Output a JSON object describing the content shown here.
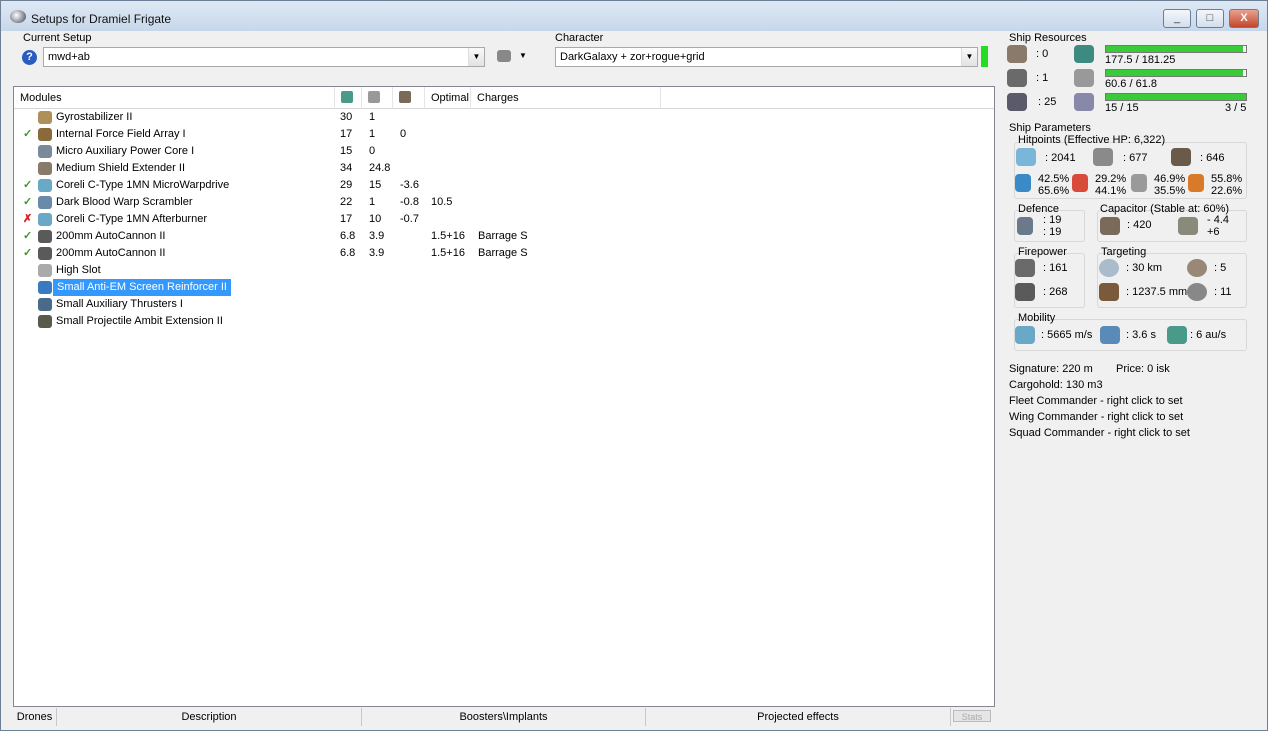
{
  "window": {
    "title": "Setups for Dramiel Frigate",
    "buttons": [
      "_",
      "□",
      "X"
    ]
  },
  "setup": {
    "label": "Current Setup",
    "value": "mwd+ab"
  },
  "character": {
    "label": "Character",
    "value": "DarkGalaxy + zor+rogue+grid"
  },
  "modules": {
    "columns": [
      "Modules",
      "Optimal",
      "Charges"
    ],
    "rows": [
      {
        "status": "",
        "name": "Gyrostabilizer II",
        "cpu": "30",
        "pg": "1",
        "cap": "",
        "optimal": "",
        "charges": ""
      },
      {
        "status": "✓",
        "name": "Internal Force Field Array I",
        "cpu": "17",
        "pg": "1",
        "cap": "0",
        "optimal": "",
        "charges": ""
      },
      {
        "status": "",
        "name": "Micro Auxiliary Power Core I",
        "cpu": "15",
        "pg": "0",
        "cap": "",
        "optimal": "",
        "charges": ""
      },
      {
        "status": "",
        "name": "Medium Shield Extender II",
        "cpu": "34",
        "pg": "24.8",
        "cap": "",
        "optimal": "",
        "charges": ""
      },
      {
        "status": "✓",
        "name": "Coreli C-Type 1MN MicroWarpdrive",
        "cpu": "29",
        "pg": "15",
        "cap": "-3.6",
        "optimal": "",
        "charges": ""
      },
      {
        "status": "✓",
        "name": "Dark Blood Warp Scrambler",
        "cpu": "22",
        "pg": "1",
        "cap": "-0.8",
        "optimal": "10.5",
        "charges": ""
      },
      {
        "status": "✗",
        "name": "Coreli C-Type 1MN Afterburner",
        "cpu": "17",
        "pg": "10",
        "cap": "-0.7",
        "optimal": "",
        "charges": ""
      },
      {
        "status": "✓",
        "name": "200mm AutoCannon II",
        "cpu": "6.8",
        "pg": "3.9",
        "cap": "",
        "optimal": "1.5+16",
        "charges": "Barrage S"
      },
      {
        "status": "✓",
        "name": "200mm AutoCannon II",
        "cpu": "6.8",
        "pg": "3.9",
        "cap": "",
        "optimal": "1.5+16",
        "charges": "Barrage S"
      },
      {
        "status": "",
        "name": "High Slot",
        "cpu": "",
        "pg": "",
        "cap": "",
        "optimal": "",
        "charges": ""
      },
      {
        "status": "",
        "name": "Small Anti-EM Screen Reinforcer II",
        "cpu": "",
        "pg": "",
        "cap": "",
        "optimal": "",
        "charges": ""
      },
      {
        "status": "",
        "name": "Small Auxiliary Thrusters I",
        "cpu": "",
        "pg": "",
        "cap": "",
        "optimal": "",
        "charges": ""
      },
      {
        "status": "",
        "name": "Small Projectile Ambit Extension II",
        "cpu": "",
        "pg": "",
        "cap": "",
        "optimal": "",
        "charges": ""
      }
    ]
  },
  "bottom_tabs": [
    "Drones",
    "Description",
    "Boosters\\Implants",
    "Projected effects"
  ],
  "stats_button": "Stats",
  "resources": {
    "title": "Ship Resources",
    "hardpoints": [
      ": 0",
      ": 1",
      ": 25"
    ],
    "cpu": "177.5 / 181.25",
    "cpu_fill": 0.98,
    "power": "60.6 / 61.8",
    "power_fill": 0.98,
    "calibration": "15 / 15",
    "calibration_fill": 1.0,
    "drones": "3 / 5"
  },
  "params": {
    "title": "Ship Parameters",
    "hp_title": "Hitpoints (Effective HP: 6,322)",
    "hp": [
      ": 2041",
      ": 677",
      ": 646"
    ],
    "resists": [
      {
        "top": "42.5%",
        "bottom": "65.6%"
      },
      {
        "top": "29.2%",
        "bottom": "44.1%"
      },
      {
        "top": "46.9%",
        "bottom": "35.5%"
      },
      {
        "top": "55.8%",
        "bottom": "22.6%"
      }
    ],
    "defence_title": "Defence",
    "defence": [
      ": 19",
      ": 19"
    ],
    "capacitor_title": "Capacitor (Stable at: 60%)",
    "capacitor": ": 420",
    "cap_delta": [
      "- 4.4",
      "+6"
    ],
    "firepower_title": "Firepower",
    "firepower": [
      ": 161",
      ": 268"
    ],
    "targeting_title": "Targeting",
    "targeting": [
      ": 30 km",
      ": 5",
      ": 1237.5 mm",
      ": 11"
    ],
    "mobility_title": "Mobility",
    "mobility": [
      ": 5665 m/s",
      ": 3.6 s",
      ": 6 au/s"
    ],
    "signature": "Signature: 220 m",
    "price": "Price: 0 isk",
    "cargo": "Cargohold: 130 m3",
    "fleet": "Fleet Commander - right click to set",
    "wing": "Wing Commander - right click to set",
    "squad": "Squad Commander - right click to set"
  },
  "colors": {
    "accent": "#3399ff",
    "bar": "#38cc38",
    "ok": "#3a9a2a",
    "bad": "#d42020"
  }
}
